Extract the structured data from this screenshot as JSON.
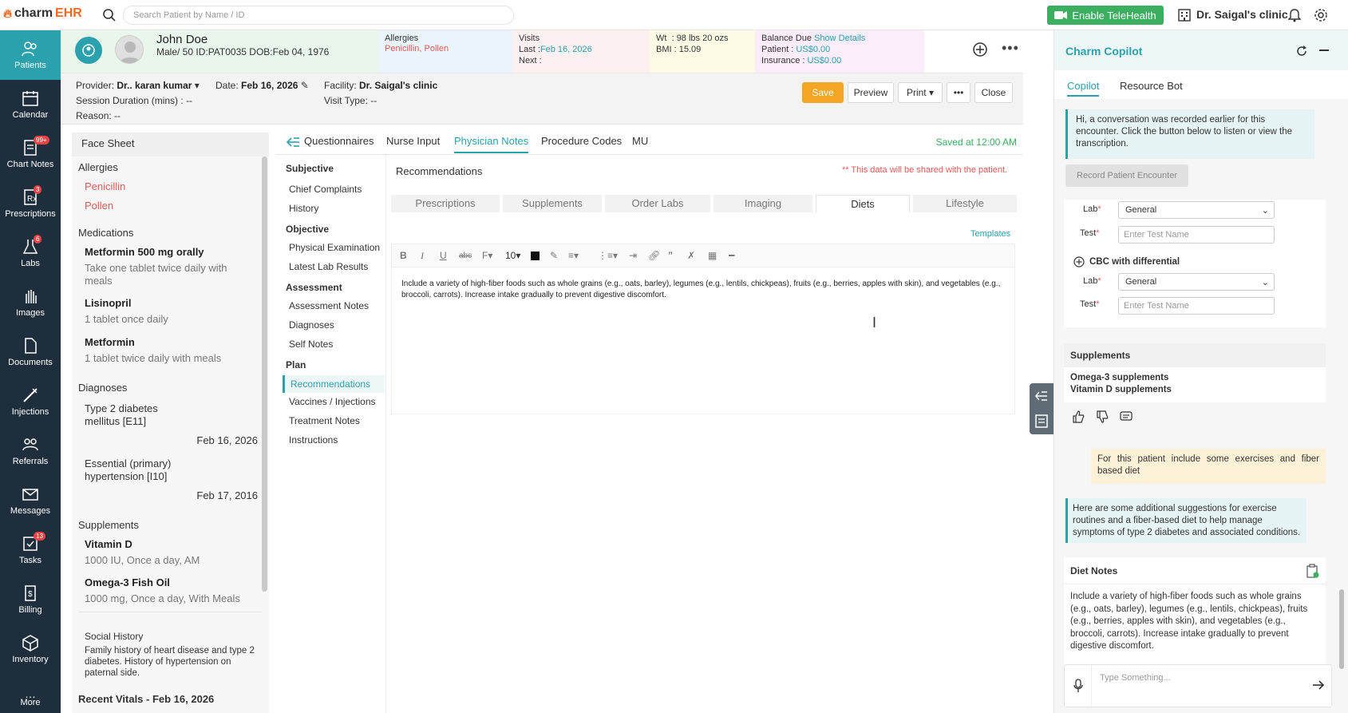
{
  "app": {
    "brand_prefix": "charm",
    "brand_suffix": "EHR"
  },
  "search": {
    "placeholder": "Search Patient by Name / ID"
  },
  "topbar": {
    "telehealth_label": "Enable TeleHealth",
    "clinic_name": "Dr. Saigal's clinic"
  },
  "nav": {
    "items": [
      {
        "label": "Patients",
        "icon": "patients-icon",
        "active": true
      },
      {
        "label": "Calendar",
        "icon": "calendar-icon"
      },
      {
        "label": "Chart Notes",
        "icon": "chart-notes-icon",
        "badge": "99+"
      },
      {
        "label": "Prescriptions",
        "icon": "prescriptions-icon",
        "badge": "3"
      },
      {
        "label": "Labs",
        "icon": "labs-icon",
        "badge": "6"
      },
      {
        "label": "Images",
        "icon": "images-icon"
      },
      {
        "label": "Documents",
        "icon": "documents-icon"
      },
      {
        "label": "Injections",
        "icon": "injections-icon"
      },
      {
        "label": "Referrals",
        "icon": "referrals-icon"
      },
      {
        "label": "Messages",
        "icon": "messages-icon"
      },
      {
        "label": "Tasks",
        "icon": "tasks-icon",
        "badge": "13"
      },
      {
        "label": "Billing",
        "icon": "billing-icon"
      },
      {
        "label": "Inventory",
        "icon": "inventory-icon"
      },
      {
        "label": "More",
        "icon": "more-icon"
      }
    ]
  },
  "patient": {
    "name": "John Doe",
    "details": "Male/ 50 ID:PAT0035 DOB:Feb 04, 1976",
    "allergies_title": "Allergies",
    "allergies": "Penicillin, Pollen",
    "visits_title": "Visits",
    "visits_last_label": "Last  :",
    "visits_last": "Feb 16, 2026",
    "visits_next_label": "Next :",
    "wt_label": "Wt",
    "wt": ": 98 lbs 20 ozs",
    "bmi_label": "BMI",
    "bmi": ": 15.09",
    "balance_title": "Balance Due",
    "balance_link": "Show Details",
    "patient_label": "Patient :",
    "patient_balance": "US$0.00",
    "insurance_label": "Insurance :",
    "insurance_balance": "US$0.00"
  },
  "encounter": {
    "provider_label": "Provider:",
    "provider": "Dr.. karan kumar",
    "date_label": "Date:",
    "date": "Feb 16, 2026",
    "facility_label": "Facility:",
    "facility": "Dr. Saigal's clinic",
    "session_label": "Session Duration (mins) :",
    "session": "--",
    "visit_type_label": "Visit Type:",
    "visit_type": "--",
    "reason_label": "Reason:",
    "reason": "--",
    "save": "Save",
    "preview": "Preview",
    "print": "Print",
    "close": "Close"
  },
  "facesheet": {
    "title": "Face Sheet",
    "allergies_title": "Allergies",
    "allergies": [
      "Penicillin",
      "Pollen"
    ],
    "medications_title": "Medications",
    "medications": [
      {
        "name": "Metformin 500 mg orally",
        "sig": "Take one tablet twice daily with meals"
      },
      {
        "name": "Lisinopril",
        "sig": "1 tablet once daily"
      },
      {
        "name": "Metformin",
        "sig": "1 tablet twice daily with meals"
      }
    ],
    "diagnoses_title": "Diagnoses",
    "diagnoses": [
      {
        "name_line1": "Type 2 diabetes",
        "name_line2": "mellitus [E11]",
        "date": "Feb 16, 2026"
      },
      {
        "name_line1": "Essential (primary)",
        "name_line2": "hypertension [I10]",
        "date": "Feb 17, 2016"
      }
    ],
    "supplements_title": "Supplements",
    "supplements": [
      {
        "name": "Vitamin D",
        "sig": "1000 IU, Once a day, AM"
      },
      {
        "name": "Omega-3 Fish Oil",
        "sig": "1000 mg, Once a day, With Meals"
      }
    ],
    "social_title": "Social History",
    "social_text": "Family history of heart disease and type 2 diabetes. History of hypertension on paternal side.",
    "vitals_title": "Recent Vitals - Feb 16, 2026"
  },
  "tabs": {
    "items": [
      "Questionnaires",
      "Nurse Input",
      "Physician Notes",
      "Procedure Codes",
      "MU"
    ],
    "active": "Physician Notes",
    "saved": "Saved at 12:00 AM"
  },
  "subnav": {
    "subjective": "Subjective",
    "chief": "Chief Complaints",
    "history": "History",
    "objective": "Objective",
    "physical": "Physical Examination",
    "latest_labs": "Latest Lab Results",
    "assessment": "Assessment",
    "assessment_notes": "Assessment Notes",
    "diagnoses": "Diagnoses",
    "self_notes": "Self Notes",
    "plan": "Plan",
    "recommendations": "Recommendations",
    "vaccines": "Vaccines / Injections",
    "treatment": "Treatment Notes",
    "instructions": "Instructions"
  },
  "recommendations": {
    "title": "Recommendations",
    "share_note": "** This data will be shared with the patient.",
    "subtabs": [
      "Prescriptions",
      "Supplements",
      "Order Labs",
      "Imaging",
      "Diets",
      "Lifestyle"
    ],
    "active_subtab": "Diets",
    "templates": "Templates",
    "font_size": "10",
    "editor_text": "Include a variety of high-fiber foods such as whole grains (e.g., oats, barley), legumes (e.g., lentils, chickpeas), fruits (e.g., berries, apples with skin), and vegetables (e.g., broccoli, carrots). Increase intake gradually to prevent digestive discomfort."
  },
  "copilot": {
    "title": "Charm Copilot",
    "tab_copilot": "Copilot",
    "tab_resource": "Resource Bot",
    "intro": "Hi, a conversation was recorded earlier for this encounter. Click the button below to listen or view the transcription.",
    "record_btn": "Record Patient Encounter",
    "lab_label": "Lab",
    "test_label": "Test",
    "lab_value": "General",
    "test_placeholder": "Enter Test Name",
    "cbc": "CBC with differential",
    "supp_title": "Supplements",
    "supp_line1": "Omega-3 supplements",
    "supp_line2": "Vitamin D supplements",
    "user_msg": "For this patient include some exercises and fiber based diet",
    "bot_msg": "Here are some additional suggestions for exercise routines and a fiber-based diet to help manage symptoms of type 2 diabetes and associated conditions.",
    "diet_title": "Diet Notes",
    "diet_text": "Include a variety of high-fiber foods such as whole grains (e.g., oats, barley), legumes (e.g., lentils, chickpeas), fruits (e.g., berries, apples with skin), and vegetables (e.g., broccoli, carrots). Increase intake gradually to prevent digestive discomfort.",
    "chat_placeholder": "Type Something..."
  },
  "colors": {
    "accent": "#2aa1ad",
    "nav_bg": "#1e2e3c",
    "save": "#f5a623",
    "telehealth": "#3bae5f",
    "alert": "#e35a5a"
  }
}
